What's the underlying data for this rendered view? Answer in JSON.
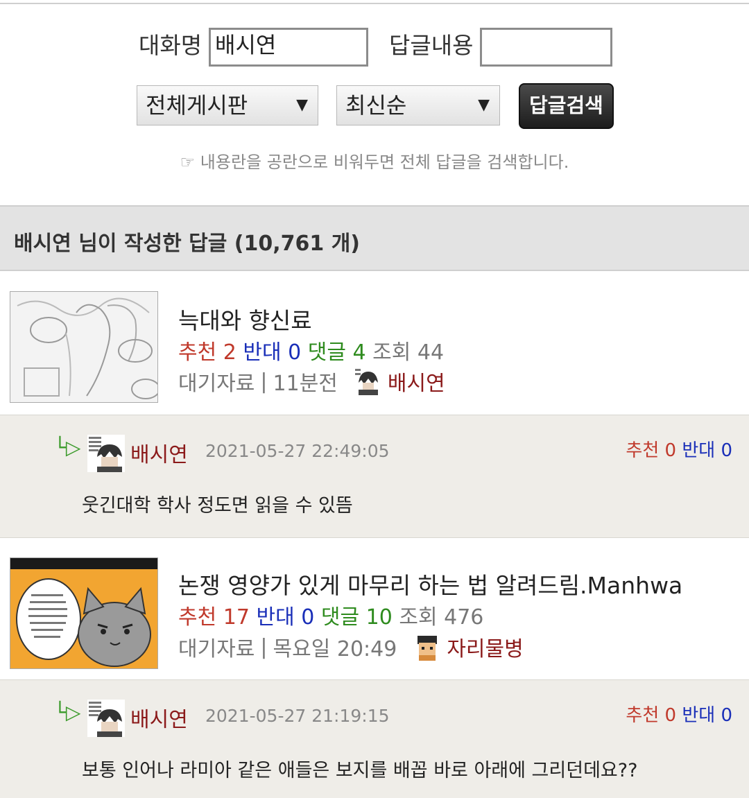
{
  "search": {
    "nickname_label": "대화명",
    "nickname_value": "배시연",
    "content_label": "답글내용",
    "content_value": "",
    "board_select": "전체게시판",
    "sort_select": "최신순",
    "search_button": "답글검색",
    "hint": "☞ 내용란을 공란으로 비워두면 전체 답글을 검색합니다."
  },
  "section": {
    "title": "배시연 님이 작성한 답글 (10,761 개)"
  },
  "labels": {
    "recommend": "추천",
    "oppose": "반대",
    "comments": "댓글",
    "views": "조회",
    "sep": "|"
  },
  "posts": [
    {
      "title": "늑대와 향신료",
      "recommend": "2",
      "oppose": "0",
      "comments": "4",
      "views": "44",
      "category": "대기자료",
      "time": "11분전",
      "author": "배시연",
      "reply": {
        "arrow": "└▷",
        "author": "배시연",
        "date": "2021-05-27 22:49:05",
        "recommend": "0",
        "oppose": "0",
        "body": "웃긴대학 학사 정도면 읽을 수 있뜸"
      }
    },
    {
      "title": "논쟁 영양가 있게 마무리 하는 법 알려드림.Manhwa",
      "recommend": "17",
      "oppose": "0",
      "comments": "10",
      "views": "476",
      "category": "대기자료",
      "time": "목요일 20:49",
      "author": "자리물병",
      "reply": {
        "arrow": "└▷",
        "author": "배시연",
        "date": "2021-05-27 21:19:15",
        "recommend": "0",
        "oppose": "0",
        "body": "보통 인어나 라미아 같은 애들은 보지를 배꼽 바로 아래에 그리던데요??"
      }
    }
  ],
  "colors": {
    "recommend": "#c0392b",
    "oppose": "#1a2fb8",
    "comments": "#2e8b1e",
    "author": "#8b1a1a",
    "reply_bg": "#efede8",
    "header_bg": "#e3e3e3"
  }
}
